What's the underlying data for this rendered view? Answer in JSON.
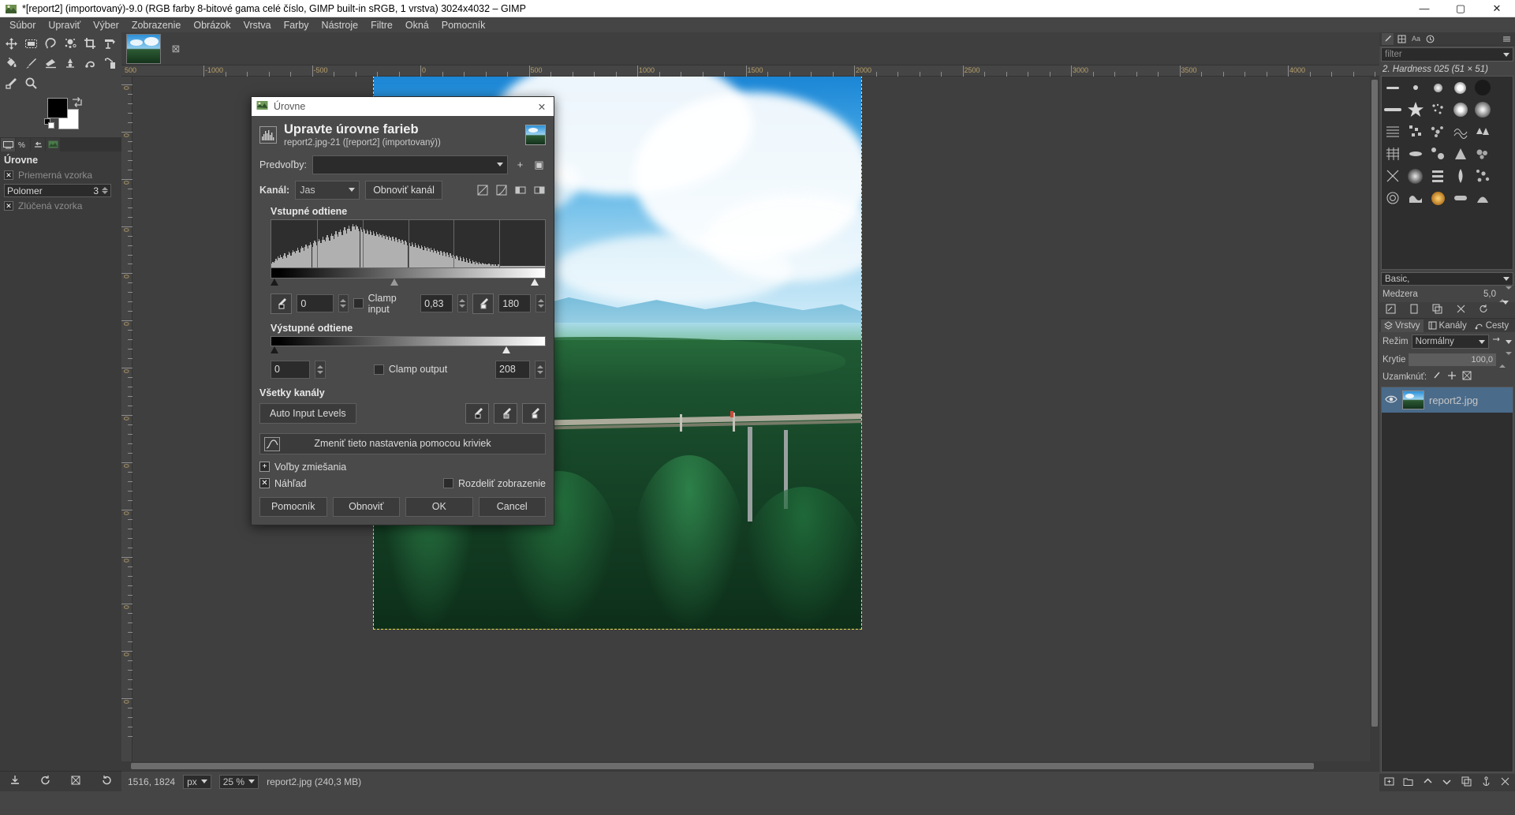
{
  "window": {
    "title": "*[report2] (importovaný)-9.0 (RGB farby 8-bitové gama celé číslo, GIMP built-in sRGB, 1 vrstva) 3024x4032 – GIMP",
    "minimize": "—",
    "maximize": "▢",
    "close": "✕"
  },
  "menubar": {
    "items": [
      "Súbor",
      "Upraviť",
      "Výber",
      "Zobrazenie",
      "Obrázok",
      "Vrstva",
      "Farby",
      "Nástroje",
      "Filtre",
      "Okná",
      "Pomocník"
    ]
  },
  "toolbox": {
    "tools": [
      {
        "name": "move-tool"
      },
      {
        "name": "rect-select-tool"
      },
      {
        "name": "free-select-tool"
      },
      {
        "name": "fuzzy-select-tool"
      },
      {
        "name": "crop-tool"
      },
      {
        "name": "transform-tool"
      },
      {
        "name": "bucket-fill-tool"
      },
      {
        "name": "paintbrush-tool"
      },
      {
        "name": "eraser-tool"
      },
      {
        "name": "smudge-tool"
      },
      {
        "name": "free-path-tool"
      },
      {
        "name": "clone-tool"
      },
      {
        "name": "color-picker-tool"
      },
      {
        "name": "zoom-tool"
      }
    ],
    "foreground_color": "#000000",
    "background_color": "#ffffff"
  },
  "tool_options": {
    "title": "Úrovne",
    "average_sample_label": "Priemerná vzorka",
    "average_sample_checked": true,
    "radius_label": "Polomer",
    "radius_value": "3",
    "merged_sample_label": "Zlúčená vzorka",
    "merged_sample_checked": true
  },
  "image_tab": {
    "close_glyph": "⊠"
  },
  "rulers": {
    "top_labels": [
      "-1000",
      "-500",
      "0",
      "500",
      "1000",
      "1500",
      "2000",
      "2500",
      "3000",
      "3500",
      "4000"
    ],
    "left_labels": [
      "0",
      "0",
      "0",
      "0",
      "0",
      "0",
      "0",
      "0",
      "0",
      "0",
      "0",
      "0",
      "0",
      "0"
    ],
    "corner_label": "500"
  },
  "statusbar": {
    "pointer": "1516, 1824",
    "unit": "px",
    "zoom": "25 %",
    "filename": "report2.jpg (240,3 MB)"
  },
  "brushes": {
    "filter_placeholder": "filter",
    "selected_brush": "2. Hardness 025 (51 × 51)",
    "tag_label": "Basic,",
    "spacing_label": "Medzera",
    "spacing_value": "5,0"
  },
  "layers_panel": {
    "tabs": [
      {
        "label": "Vrstvy",
        "icon": "layers-icon",
        "active": true
      },
      {
        "label": "Kanály",
        "icon": "channels-icon",
        "active": false
      },
      {
        "label": "Cesty",
        "icon": "paths-icon",
        "active": false
      }
    ],
    "mode_label": "Režim",
    "mode_value": "Normálny",
    "opacity_label": "Krytie",
    "opacity_value": "100,0",
    "lock_label": "Uzamknúť:",
    "layers": [
      {
        "name": "report2.jpg",
        "visible": true
      }
    ]
  },
  "levels_dialog": {
    "titlebar_text": "Úrovne",
    "titlebar_close": "✕",
    "heading": "Upravte úrovne farieb",
    "subheading": "report2.jpg-21 ([report2] (importovaný))",
    "presets_label": "Predvoľby:",
    "presets_value": "",
    "preset_add_glyph": "+",
    "preset_menu_glyph": "▣",
    "channel_label": "Kanál:",
    "channel_value": "Jas",
    "reset_channel_button": "Obnoviť kanál",
    "input_section_title": "Vstupné odtiene",
    "output_section_title": "Výstupné odtiene",
    "all_channels_title": "Všetky kanály",
    "clamp_input_label": "Clamp input",
    "clamp_input_checked": false,
    "clamp_output_label": "Clamp output",
    "clamp_output_checked": false,
    "input_low": "0",
    "input_gamma": "0,83",
    "input_high": "180",
    "output_low": "0",
    "output_high": "208",
    "auto_input_levels_button": "Auto Input Levels",
    "edit_curves_button": "Zmeniť tieto nastavenia pomocou kriviek",
    "blend_options_label": "Voľby zmiešania",
    "preview_label": "Náhľad",
    "preview_checked": true,
    "split_view_label": "Rozdeliť zobrazenie",
    "split_view_checked": false,
    "buttons": {
      "help": "Pomocník",
      "reset": "Obnoviť",
      "ok": "OK",
      "cancel": "Cancel"
    },
    "histogram": [
      4,
      6,
      5,
      7,
      9,
      8,
      12,
      10,
      14,
      11,
      9,
      13,
      15,
      12,
      10,
      14,
      17,
      15,
      13,
      16,
      19,
      17,
      15,
      18,
      21,
      19,
      16,
      20,
      23,
      21,
      18,
      22,
      25,
      23,
      20,
      24,
      27,
      25,
      22,
      26,
      29,
      27,
      24,
      28,
      31,
      29,
      26,
      30,
      33,
      30,
      28,
      32,
      35,
      32,
      29,
      34,
      37,
      34,
      31,
      36,
      39,
      36,
      33,
      38,
      41,
      38,
      35,
      40,
      43,
      40,
      37,
      42,
      45,
      42,
      39,
      44,
      47,
      44,
      41,
      46,
      44,
      42,
      39,
      43,
      41,
      38,
      42,
      40,
      37,
      41,
      39,
      36,
      40,
      38,
      35,
      39,
      37,
      34,
      38,
      36,
      33,
      37,
      35,
      32,
      36,
      34,
      31,
      35,
      33,
      30,
      34,
      32,
      29,
      33,
      31,
      28,
      32,
      30,
      27,
      31,
      29,
      26,
      30,
      28,
      25,
      29,
      27,
      24,
      28,
      26,
      23,
      27,
      25,
      22,
      26,
      24,
      21,
      25,
      23,
      20,
      24,
      22,
      19,
      23,
      21,
      18,
      22,
      20,
      17,
      21,
      19,
      16,
      20,
      18,
      15,
      19,
      17,
      14,
      18,
      16,
      13,
      17,
      15,
      12,
      16,
      14,
      11,
      15,
      13,
      10,
      14,
      12,
      9,
      13,
      11,
      8,
      12,
      10,
      7,
      11,
      9,
      6,
      10,
      8,
      5,
      9,
      7,
      4,
      8,
      6,
      3,
      7,
      5,
      3,
      6,
      4,
      3,
      5,
      4,
      3,
      4,
      3,
      3,
      4,
      3,
      2,
      3,
      3,
      2,
      3,
      2,
      2,
      3,
      2,
      2,
      2,
      2,
      2,
      2,
      2,
      2,
      2,
      2,
      2,
      2,
      2,
      2,
      2,
      2,
      2,
      2,
      2,
      2,
      2,
      2,
      2,
      2,
      2,
      2,
      2,
      2,
      2,
      2,
      2,
      2,
      2,
      2,
      2,
      2,
      2,
      2,
      2,
      2,
      2,
      2,
      2
    ]
  }
}
